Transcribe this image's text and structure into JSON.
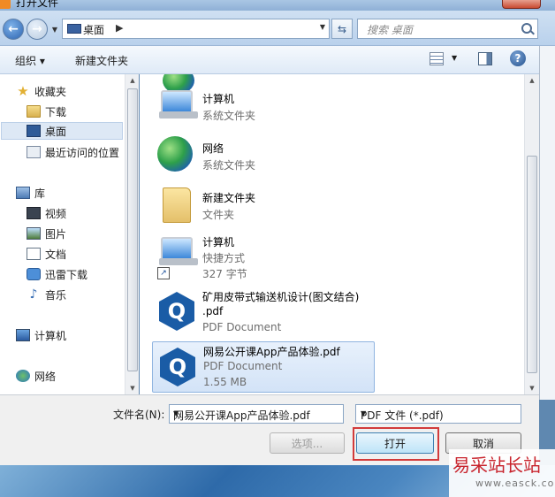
{
  "window": {
    "title": "打开文件"
  },
  "nav": {
    "address_location": "桌面",
    "search_placeholder": "搜索 桌面"
  },
  "toolbar": {
    "organize": "组织 ▾",
    "new_folder": "新建文件夹"
  },
  "sidebar": {
    "favorites_header": "收藏夹",
    "favorites": [
      "下载",
      "桌面",
      "最近访问的位置"
    ],
    "libraries_header": "库",
    "libraries": [
      "视频",
      "图片",
      "文档",
      "迅雷下载",
      "音乐"
    ],
    "computer": "计算机",
    "network": "网络",
    "selected": "桌面"
  },
  "files": [
    {
      "name": "计算机",
      "lines": [
        "系统文件夹"
      ],
      "icon": "computer-icon"
    },
    {
      "name": "网络",
      "lines": [
        "系统文件夹"
      ],
      "icon": "network-icon"
    },
    {
      "name": "新建文件夹",
      "lines": [
        "文件夹"
      ],
      "icon": "folder-icon"
    },
    {
      "name": "计算机",
      "lines": [
        "快捷方式",
        "327 字节"
      ],
      "icon": "computer-shortcut-icon"
    },
    {
      "name": "矿用皮带式输送机设计(图文结合)",
      "name2": ".pdf",
      "lines": [
        "PDF Document"
      ],
      "icon": "pdf-q-icon"
    },
    {
      "name": "网易公开课App产品体验.pdf",
      "lines": [
        "PDF Document",
        "1.55 MB"
      ],
      "icon": "pdf-q-icon",
      "selected": true
    }
  ],
  "bottom": {
    "filename_label": "文件名(N):",
    "filename_value": "网易公开课App产品体验.pdf",
    "filetype_value": "PDF 文件 (*.pdf)",
    "options_label": "选项...",
    "open_label": "打开",
    "cancel_label": "取消"
  },
  "watermark": {
    "text": "易采站长站",
    "url": "www.easck.com"
  },
  "colors": {
    "accent": "#3c7fb1",
    "highlight": "#d23b3b",
    "selection": "#d3e3f7"
  }
}
